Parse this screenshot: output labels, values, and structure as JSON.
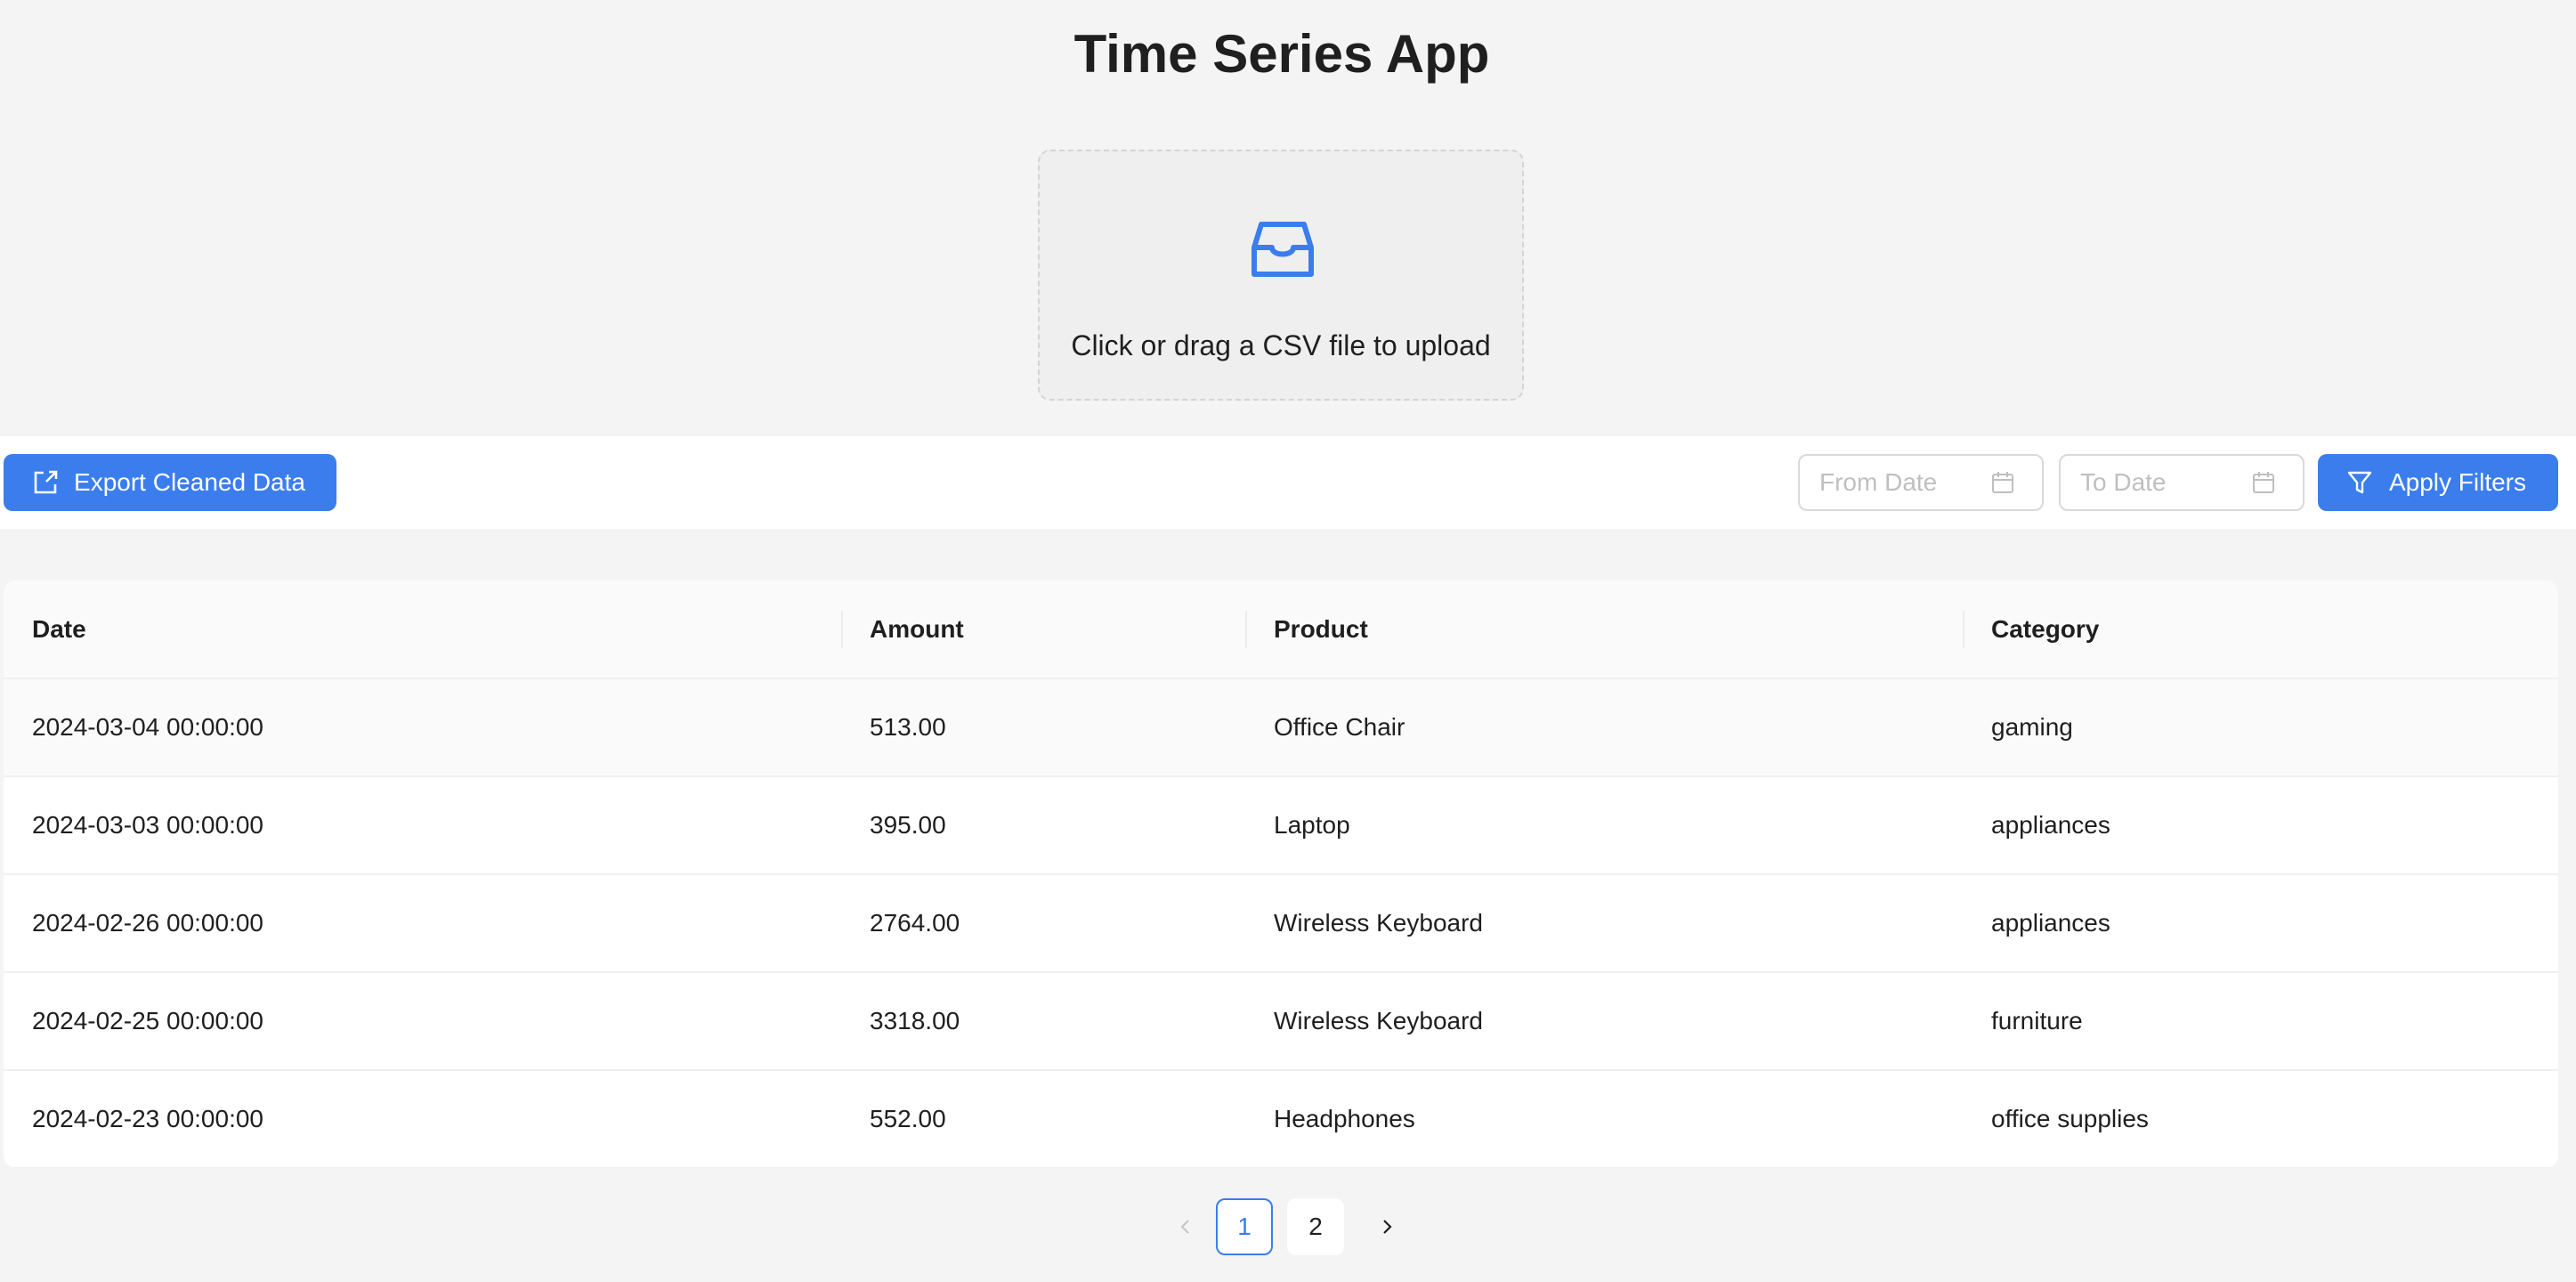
{
  "app": {
    "title": "Time Series App"
  },
  "upload": {
    "hint": "Click or drag a CSV file to upload",
    "icon": "inbox-icon"
  },
  "toolbar": {
    "export_label": "Export Cleaned Data",
    "from_placeholder": "From Date",
    "to_placeholder": "To Date",
    "apply_label": "Apply Filters"
  },
  "table": {
    "columns": [
      "Date",
      "Amount",
      "Product",
      "Category"
    ],
    "rows": [
      [
        "2024-03-04 00:00:00",
        "513.00",
        "Office Chair",
        "gaming"
      ],
      [
        "2024-03-03 00:00:00",
        "395.00",
        "Laptop",
        "appliances"
      ],
      [
        "2024-02-26 00:00:00",
        "2764.00",
        "Wireless Keyboard",
        "appliances"
      ],
      [
        "2024-02-25 00:00:00",
        "3318.00",
        "Wireless Keyboard",
        "furniture"
      ],
      [
        "2024-02-23 00:00:00",
        "552.00",
        "Headphones",
        "office supplies"
      ]
    ]
  },
  "pagination": {
    "pages": [
      "1",
      "2"
    ],
    "current": "1"
  },
  "colors": {
    "accent": "#3b7ded",
    "background": "#f4f4f4"
  }
}
